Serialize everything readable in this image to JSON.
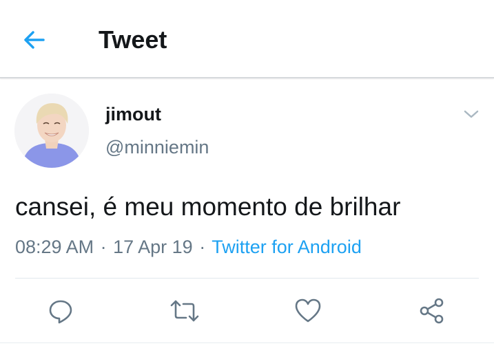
{
  "header": {
    "title": "Tweet",
    "back_icon": "arrow-left-icon"
  },
  "tweet": {
    "display_name": "jimout",
    "handle": "@minniemin",
    "text": "cansei, é meu momento de brilhar",
    "time": "08:29 AM",
    "date": "17 Apr 19",
    "separator": "·",
    "source": "Twitter for Android",
    "menu_icon": "chevron-down-icon"
  },
  "actions": {
    "reply_icon": "reply-icon",
    "retweet_icon": "retweet-icon",
    "like_icon": "heart-icon",
    "share_icon": "share-icon"
  },
  "colors": {
    "accent": "#1da1f2",
    "text_primary": "#14171a",
    "text_secondary": "#657786",
    "icon": "#657786",
    "avatar_shirt": "#8b96e8",
    "avatar_hair": "#ead9b3"
  }
}
